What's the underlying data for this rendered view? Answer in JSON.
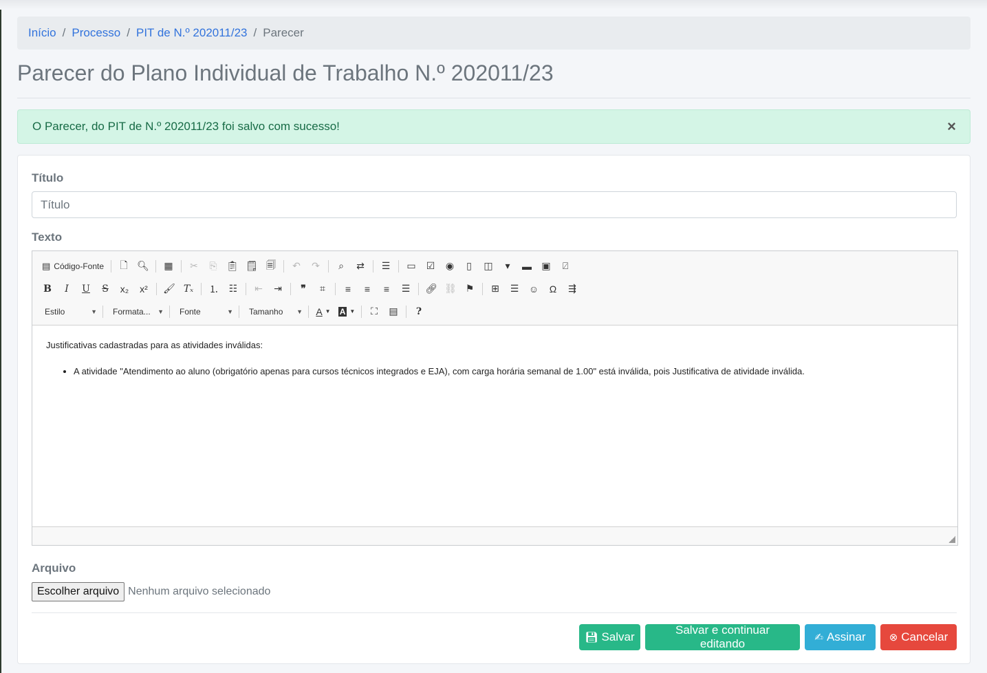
{
  "breadcrumb": {
    "items": [
      {
        "label": "Início"
      },
      {
        "label": "Processo"
      },
      {
        "label": "PIT de N.º 202011/23"
      }
    ],
    "separator": "/",
    "current": "Parecer"
  },
  "page_title": "Parecer do Plano Individual de Trabalho N.º 202011/23",
  "alert": {
    "message": "O Parecer, do PIT de N.º 202011/23 foi salvo com sucesso!",
    "close": "×"
  },
  "form": {
    "titulo_label": "Título",
    "titulo_placeholder": "Título",
    "titulo_value": "",
    "texto_label": "Texto",
    "arquivo_label": "Arquivo",
    "file_button": "Escolher arquivo",
    "file_status": "Nenhum arquivo selecionado"
  },
  "editor": {
    "source_label": "Código-Fonte",
    "combos": {
      "estilo": "Estilo",
      "formatacao": "Formata...",
      "fonte": "Fonte",
      "tamanho": "Tamanho"
    },
    "content": {
      "intro": "Justificativas cadastradas para as atividades inválidas:",
      "items": [
        "A atividade \"Atendimento ao aluno (obrigatório apenas para cursos técnicos integrados e EJA), com carga horária semanal de 1.00\" está inválida, pois Justificativa de atividade inválida."
      ]
    }
  },
  "buttons": {
    "save": "Salvar",
    "save_continue": "Salvar e continuar editando",
    "sign": "Assinar",
    "cancel": "Cancelar"
  },
  "colors": {
    "success": "#28b888",
    "info": "#32aed6",
    "danger": "#e6483d",
    "link": "#3273dc"
  }
}
